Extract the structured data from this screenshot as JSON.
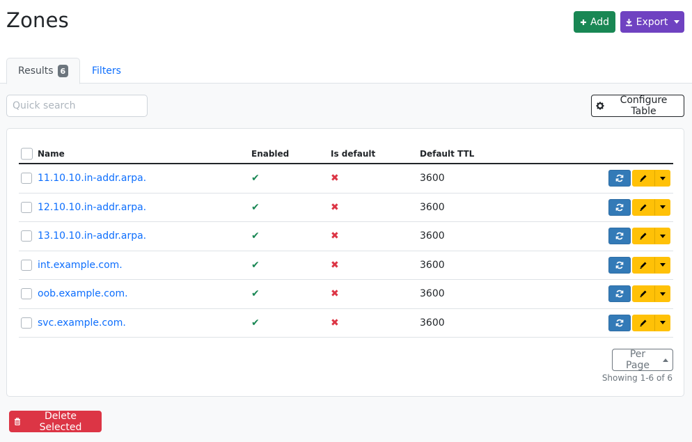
{
  "page": {
    "title": "Zones"
  },
  "header": {
    "add_label": "Add",
    "export_label": "Export"
  },
  "tabs": {
    "results_label": "Results",
    "results_count": "6",
    "filters_label": "Filters"
  },
  "toolbar": {
    "search_placeholder": "Quick search",
    "search_value": "",
    "configure_label": "Configure Table"
  },
  "table": {
    "columns": [
      "Name",
      "Enabled",
      "Is default",
      "Default TTL"
    ],
    "rows": [
      {
        "name": "11.10.10.in-addr.arpa.",
        "enabled": "✔",
        "is_default": "✖",
        "ttl": "3600"
      },
      {
        "name": "12.10.10.in-addr.arpa.",
        "enabled": "✔",
        "is_default": "✖",
        "ttl": "3600"
      },
      {
        "name": "13.10.10.in-addr.arpa.",
        "enabled": "✔",
        "is_default": "✖",
        "ttl": "3600"
      },
      {
        "name": "int.example.com.",
        "enabled": "✔",
        "is_default": "✖",
        "ttl": "3600"
      },
      {
        "name": "oob.example.com.",
        "enabled": "✔",
        "is_default": "✖",
        "ttl": "3600"
      },
      {
        "name": "svc.example.com.",
        "enabled": "✔",
        "is_default": "✖",
        "ttl": "3600"
      }
    ]
  },
  "pagination": {
    "per_page_label": "Per Page",
    "showing_text": "Showing 1-6 of 6"
  },
  "footer": {
    "delete_label": "Delete Selected"
  },
  "colors": {
    "add": "#198754",
    "export": "#6f42c1",
    "sync": "#337ab7",
    "edit": "#ffc107",
    "delete": "#dc3545",
    "link": "#0d6efd",
    "enabled_true": "#198754",
    "is_default_false": "#dc3545"
  }
}
